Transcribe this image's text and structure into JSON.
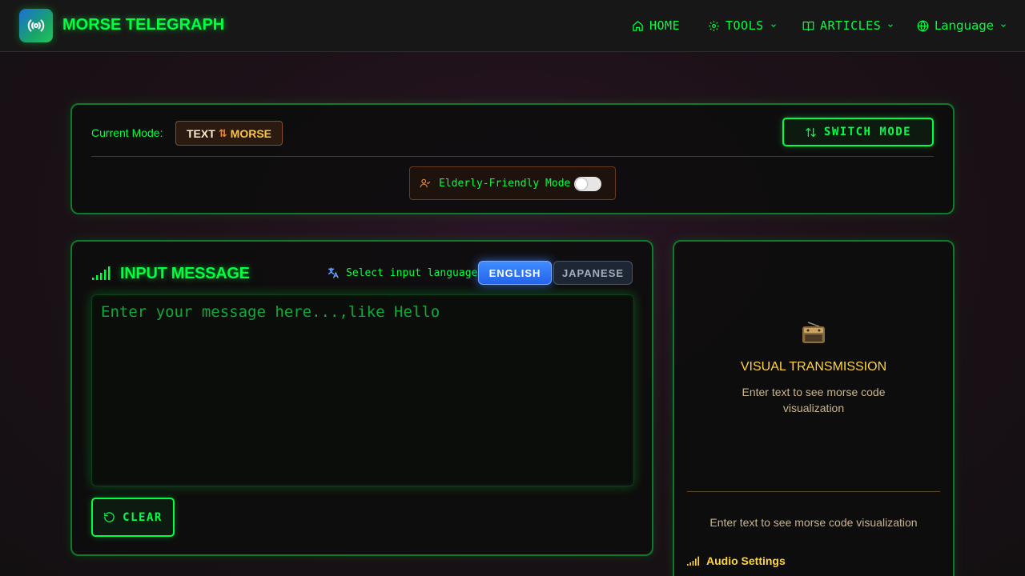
{
  "header": {
    "brand": "MORSE TELEGRAPH",
    "nav": {
      "home": "HOME",
      "tools": "TOOLS",
      "articles": "ARTICLES",
      "language": "Language"
    },
    "icons": [
      "broadcast-icon",
      "home-icon",
      "gear-icon",
      "book-icon",
      "globe-icon",
      "chevron-down-icon"
    ]
  },
  "mode": {
    "label": "Current Mode:",
    "from": "TEXT",
    "arrows": "⇅",
    "to": "MORSE",
    "switch_label": "SWITCH MODE",
    "elderly_label": "Elderly-Friendly Mode",
    "elderly_enabled": false
  },
  "input": {
    "title": "INPUT MESSAGE",
    "select_language_label": "Select input language:",
    "languages": [
      "ENGLISH",
      "JAPANESE"
    ],
    "selected_language": "ENGLISH",
    "placeholder": "Enter your message here...,like Hello",
    "value": "",
    "clear_label": "CLEAR"
  },
  "visual": {
    "title": "VISUAL TRANSMISSION",
    "subtitle": "Enter text to see morse code visualization",
    "subtitle2": "Enter text to see morse code visualization",
    "audio_settings": "Audio Settings"
  },
  "colors": {
    "accent": "#00ff41",
    "gold": "#ffd43b",
    "blue": "#3b82f6",
    "panel_border": "#0f7a2a"
  }
}
